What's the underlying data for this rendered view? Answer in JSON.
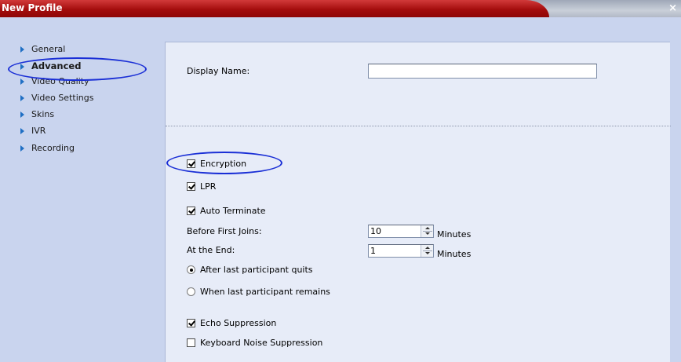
{
  "window": {
    "title": "New Profile",
    "close_glyph": "×"
  },
  "sidebar": {
    "items": [
      {
        "label": "General"
      },
      {
        "label": "Advanced",
        "active": true
      },
      {
        "label": "Video Quality"
      },
      {
        "label": "Video Settings"
      },
      {
        "label": "Skins"
      },
      {
        "label": "IVR"
      },
      {
        "label": "Recording"
      }
    ]
  },
  "form": {
    "display_name_label": "Display Name:",
    "display_name_value": "",
    "encryption": {
      "label": "Encryption",
      "checked": true
    },
    "lpr": {
      "label": "LPR",
      "checked": true
    },
    "auto_terminate": {
      "label": "Auto Terminate",
      "checked": true
    },
    "before_first_joins": {
      "label": "Before First Joins:",
      "value": "10",
      "unit": "Minutes"
    },
    "at_the_end": {
      "label": "At the End:",
      "value": "1",
      "unit": "Minutes"
    },
    "after_last_quits": {
      "label": "After last participant quits",
      "selected": true
    },
    "when_last_remains": {
      "label": "When last participant remains",
      "selected": false
    },
    "echo_suppression": {
      "label": "Echo Suppression",
      "checked": true
    },
    "keyboard_noise": {
      "label": "Keyboard Noise Suppression",
      "checked": false
    }
  },
  "colors": {
    "title_red": "#a40d0d",
    "highlight_ellipse": "#1a2fd6",
    "chevron_blue": "#1f6fc4",
    "panel_bg": "#e7ecf8",
    "sidebar_bg": "#c9d4ee"
  }
}
